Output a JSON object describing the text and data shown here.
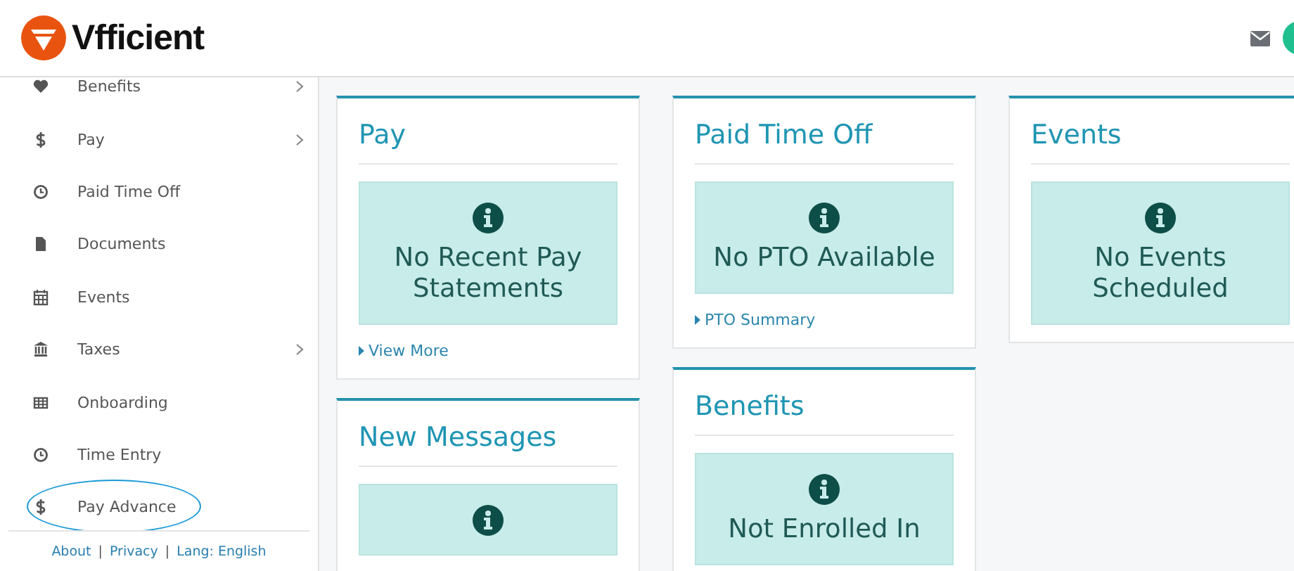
{
  "header": {
    "logo_text": "Vfficient"
  },
  "sidebar": {
    "items": [
      {
        "label": "Benefits",
        "kind": "heart",
        "has_submenu": true,
        "circled": false
      },
      {
        "label": "Pay",
        "kind": "dollar",
        "has_submenu": true,
        "circled": false
      },
      {
        "label": "Paid Time Off",
        "kind": "clock",
        "has_submenu": false,
        "circled": false
      },
      {
        "label": "Documents",
        "kind": "file",
        "has_submenu": false,
        "circled": false
      },
      {
        "label": "Events",
        "kind": "calendar",
        "has_submenu": false,
        "circled": false
      },
      {
        "label": "Taxes",
        "kind": "bank",
        "has_submenu": true,
        "circled": false
      },
      {
        "label": "Onboarding",
        "kind": "grid",
        "has_submenu": false,
        "circled": false
      },
      {
        "label": "Time Entry",
        "kind": "clock",
        "has_submenu": false,
        "circled": false
      },
      {
        "label": "Pay Advance",
        "kind": "dollar",
        "has_submenu": false,
        "circled": true
      }
    ],
    "footer": [
      {
        "kind": "link",
        "text": "About"
      },
      {
        "kind": "separator",
        "text": "|"
      },
      {
        "kind": "link",
        "text": "Privacy"
      },
      {
        "kind": "separator",
        "text": "|"
      },
      {
        "kind": "link",
        "text": "Lang: English"
      }
    ]
  },
  "columns": [
    [
      {
        "title": "Pay",
        "message": "No Recent Pay Statements",
        "link": "View More"
      },
      {
        "title": "New Messages"
      }
    ],
    [
      {
        "title": "Paid Time Off",
        "message": "No PTO Available",
        "link": "PTO Summary"
      },
      {
        "title": "Benefits",
        "message": "Not Enrolled In"
      }
    ],
    [
      {
        "title": "Events",
        "message": "No Events Scheduled"
      }
    ]
  ]
}
